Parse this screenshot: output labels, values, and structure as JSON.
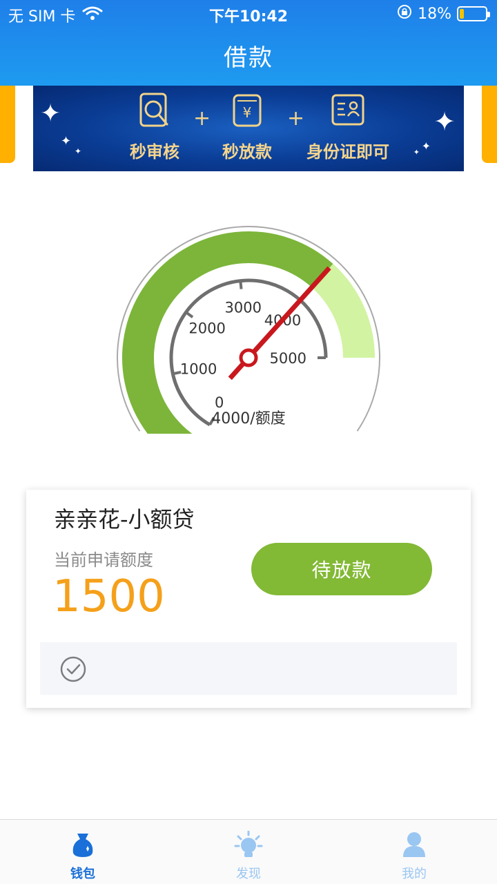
{
  "status_bar": {
    "carrier": "无 SIM 卡",
    "time": "下午10:42",
    "battery": "18%",
    "battery_level": 0.18
  },
  "header": {
    "title": "借款"
  },
  "banner": {
    "items": [
      {
        "label": "秒审核",
        "icon": "search-document-icon"
      },
      {
        "label": "秒放款",
        "icon": "yuan-card-icon"
      },
      {
        "label": "身份证即可",
        "icon": "id-card-icon"
      }
    ],
    "plus": "+"
  },
  "gauge": {
    "ticks": [
      "0",
      "1000",
      "2000",
      "3000",
      "4000",
      "5000"
    ],
    "min": 0,
    "max": 5000,
    "value": 4000,
    "caption": "4000/额度",
    "colors": {
      "filled": "#7cb53a",
      "remaining": "#d2f3a2",
      "needle": "#c8181e"
    }
  },
  "loan_card": {
    "title": "亲亲花-小额贷",
    "amount_label": "当前申请额度",
    "amount": "1500",
    "status_button": "待放款",
    "colors": {
      "amount": "#f5a01a",
      "button": "#82b935"
    }
  },
  "tab_bar": {
    "tabs": [
      {
        "label": "钱包",
        "icon": "wallet-bag-icon",
        "active": true
      },
      {
        "label": "发现",
        "icon": "lightbulb-icon",
        "active": false
      },
      {
        "label": "我的",
        "icon": "user-icon",
        "active": false
      }
    ]
  }
}
